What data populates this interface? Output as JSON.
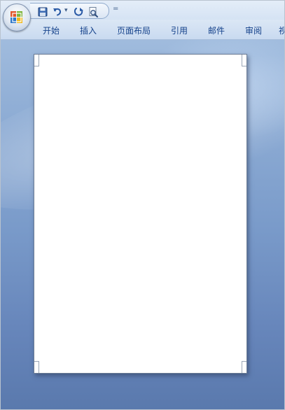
{
  "quick_access": {
    "save_icon": "save-icon",
    "undo_icon": "undo-icon",
    "dropdown_glyph": "▾",
    "redo_icon": "redo-icon",
    "print_preview_icon": "print-preview-icon",
    "customize_glyph": "="
  },
  "office_button": {
    "icon": "office-logo-icon"
  },
  "ribbon": {
    "tabs": [
      {
        "label": "开始"
      },
      {
        "label": "插入"
      },
      {
        "label": "页面布局"
      },
      {
        "label": "引用"
      },
      {
        "label": "邮件"
      },
      {
        "label": "审阅"
      },
      {
        "label": "视"
      }
    ]
  },
  "colors": {
    "tab_text": "#15428b",
    "workspace_top": "#a9c3e2",
    "workspace_bottom": "#5a79ad",
    "page": "#ffffff"
  }
}
